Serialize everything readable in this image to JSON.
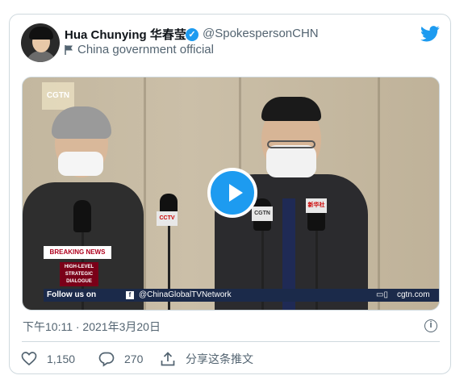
{
  "author": {
    "name": "Hua Chunying 华春莹",
    "handle": "@SpokespersonCHN",
    "label": "China government official"
  },
  "icons": {
    "verified": "verified-badge-icon",
    "flag": "flag-icon",
    "brand": "twitter-bird-icon",
    "play": "play-icon",
    "info": "info-icon",
    "like": "heart-icon",
    "reply": "reply-icon",
    "share": "share-icon"
  },
  "video": {
    "logo": "CGTN",
    "breaking": "BREAKING NEWS",
    "strapline": [
      "HIGH-LEVEL",
      "STRATEGIC",
      "DIALOGUE"
    ],
    "ticker_follow": "Follow us on",
    "ticker_account": "@ChinaGlobalTVNetwork",
    "ticker_site": "cgtn.com",
    "mic_labels": [
      "CCTV",
      "CGTN",
      "新华社"
    ]
  },
  "timestamp": "下午10:11 · 2021年3月20日",
  "actions": {
    "likes": "1,150",
    "replies": "270",
    "share": "分享这条推文"
  },
  "colors": {
    "accent": "#1d9bf0",
    "text": "#0f1419",
    "muted": "#536471",
    "border": "#cfd9de"
  }
}
